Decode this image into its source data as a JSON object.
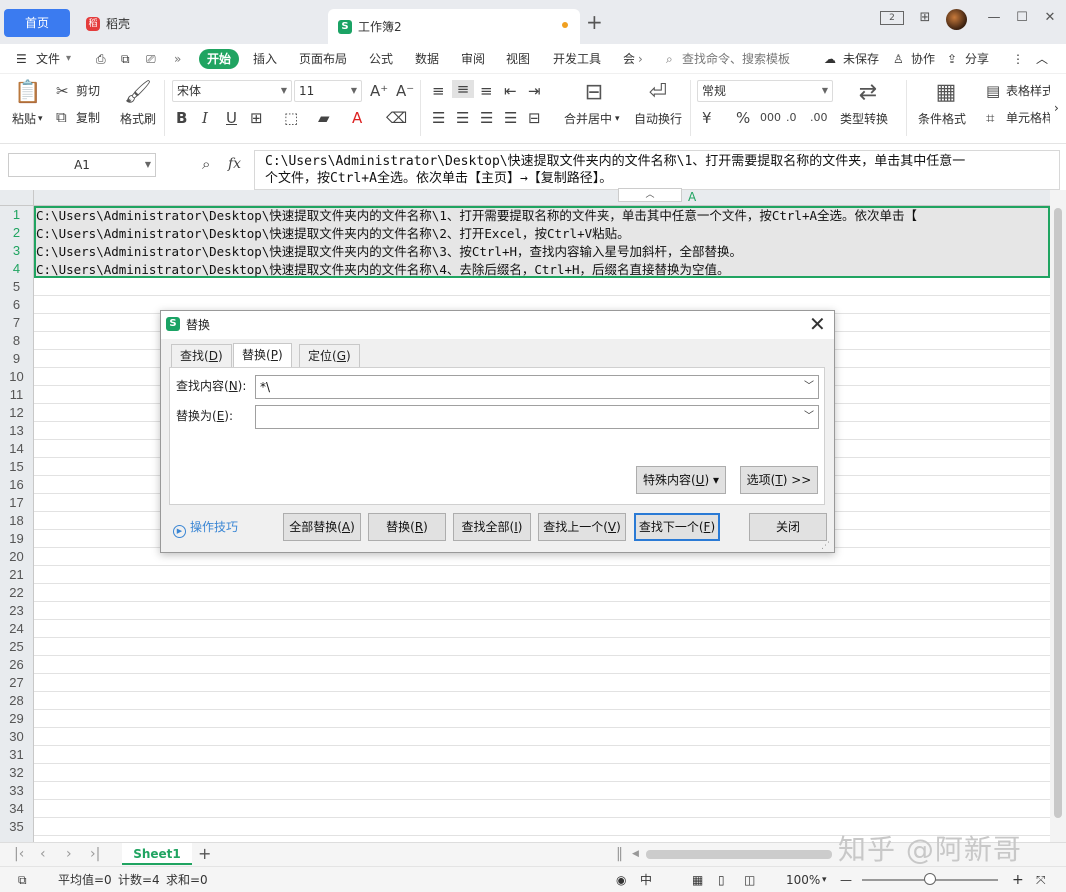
{
  "titlebar": {
    "home_tab": "首页",
    "daoke_tab": "稻壳",
    "daoke_logo": "稻",
    "workbook_tab": "工作簿2",
    "s_logo": "S"
  },
  "menu": {
    "file": "文件",
    "start": "开始",
    "insert": "插入",
    "page_layout": "页面布局",
    "formula": "公式",
    "data": "数据",
    "review": "审阅",
    "view": "视图",
    "developer": "开发工具",
    "member": "会",
    "search_placeholder": "查找命令、搜索模板",
    "unsaved": "未保存",
    "collaborate": "协作",
    "share": "分享"
  },
  "ribbon": {
    "paste": "粘贴",
    "cut": "剪切",
    "copy": "复制",
    "format_painter": "格式刷",
    "font_name": "宋体",
    "font_size": "11",
    "merge_center": "合并居中",
    "wrap_text": "自动换行",
    "number_format": "常规",
    "type_convert": "类型转换",
    "conditional_format": "条件格式",
    "table_style": "表格样式",
    "cell_style": "单元格样式"
  },
  "formula_bar": {
    "name_box": "A1",
    "fx": "fx",
    "content_line1": "C:\\Users\\Administrator\\Desktop\\快速提取文件夹内的文件名称\\1、打开需要提取名称的文件夹，单击其中任意一",
    "content_line2": "个文件，按Ctrl+A全选。依次单击【主页】→【复制路径】。"
  },
  "grid": {
    "column_label": "A",
    "rows": [
      "1",
      "2",
      "3",
      "4",
      "5",
      "6",
      "7",
      "8",
      "9",
      "10",
      "11",
      "12",
      "13",
      "14",
      "15",
      "16",
      "17",
      "18",
      "19",
      "20",
      "21",
      "22",
      "23",
      "24",
      "25",
      "26",
      "27",
      "28",
      "29",
      "30",
      "31",
      "32",
      "33",
      "34",
      "35"
    ],
    "cells": [
      "C:\\Users\\Administrator\\Desktop\\快速提取文件夹内的文件名称\\1、打开需要提取名称的文件夹，单击其中任意一个文件，按Ctrl+A全选。依次单击【",
      "C:\\Users\\Administrator\\Desktop\\快速提取文件夹内的文件名称\\2、打开Excel，按Ctrl+V粘贴。",
      "C:\\Users\\Administrator\\Desktop\\快速提取文件夹内的文件名称\\3、按Ctrl+H，查找内容输入星号加斜杆，全部替换。",
      "C:\\Users\\Administrator\\Desktop\\快速提取文件夹内的文件名称\\4、去除后缀名，Ctrl+H，后缀名直接替换为空值。"
    ]
  },
  "sheet_tabs": {
    "active": "Sheet1"
  },
  "watermark": "知乎 @阿新哥",
  "status": {
    "average": "平均值=0",
    "count": "计数=4",
    "sum": "求和=0",
    "zoom": "100%",
    "zoom_level": 0.5
  },
  "dialog": {
    "title": "替换",
    "tab_find_prefix": "查找(",
    "tab_find_key": "D",
    "tab_replace_prefix": "替换(",
    "tab_replace_key": "P",
    "tab_goto_prefix": "定位(",
    "tab_goto_key": "G",
    "find_label_prefix": "查找内容(",
    "find_label_key": "N",
    "find_value": "*\\",
    "replace_label_prefix": "替换为(",
    "replace_label_key": "E",
    "replace_value": "",
    "special_prefix": "特殊内容(",
    "special_key": "U",
    "options_prefix": "选项(",
    "options_key": "T",
    "options_suffix": ") >>",
    "tips": "操作技巧",
    "replace_all_prefix": "全部替换(",
    "replace_all_key": "A",
    "replace_prefix": "替换(",
    "replace_key": "R",
    "find_all_prefix": "查找全部(",
    "find_all_key": "I",
    "find_prev_prefix": "查找上一个(",
    "find_prev_key": "V",
    "find_next_prefix": "查找下一个(",
    "find_next_key": "F",
    "close": "关闭"
  },
  "colors": {
    "accent_green": "#20a461",
    "home_tab_blue": "#3b7bf0",
    "link_blue": "#3a86d4"
  }
}
